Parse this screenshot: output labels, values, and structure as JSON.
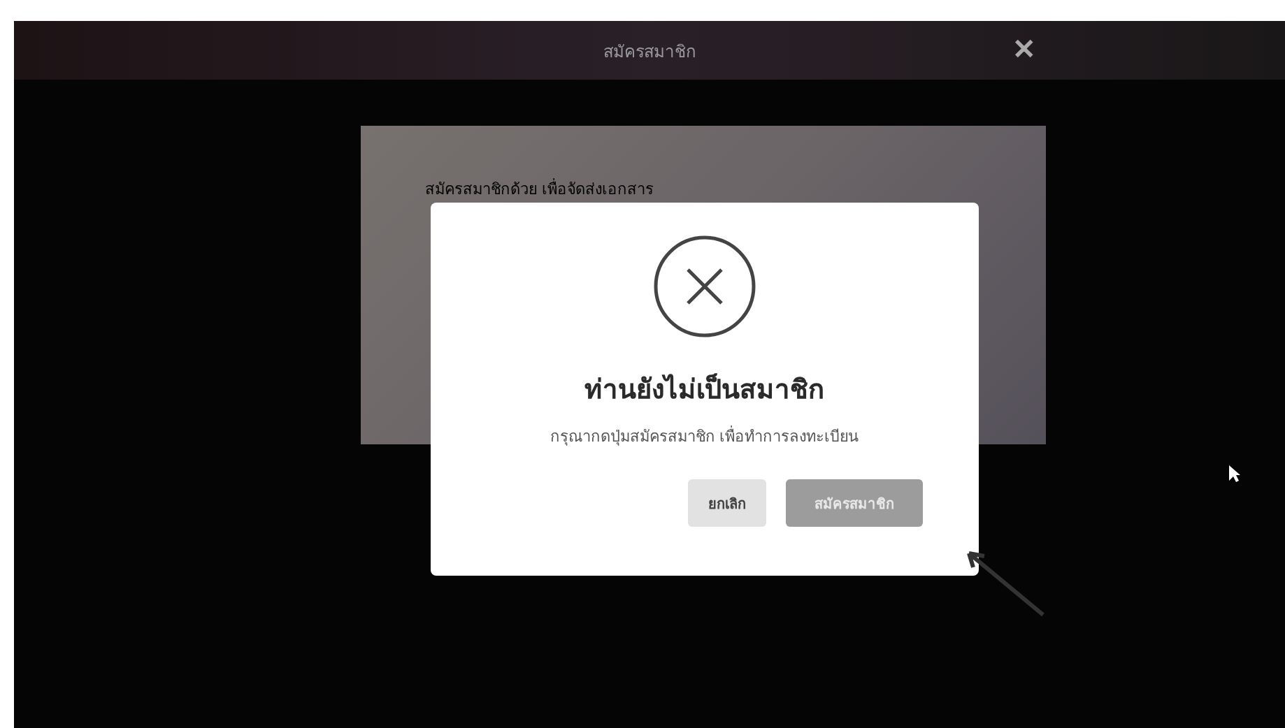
{
  "header": {
    "title": "สมัครสมาชิก",
    "close": "✕"
  },
  "card": {
    "text": "สมัครสมาชิกด้วย เพื่อจัดส่งเอกสาร"
  },
  "dialog": {
    "heading": "ท่านยังไม่เป็นสมาชิก",
    "message": "กรุณากดปุ่มสมัครสมาชิก เพื่อทำการลงทะเบียน",
    "buttons": [
      {
        "label": "ยกเลิก",
        "kind": "secondary"
      },
      {
        "label": "สมัครสมาชิก",
        "kind": "primary"
      }
    ]
  }
}
